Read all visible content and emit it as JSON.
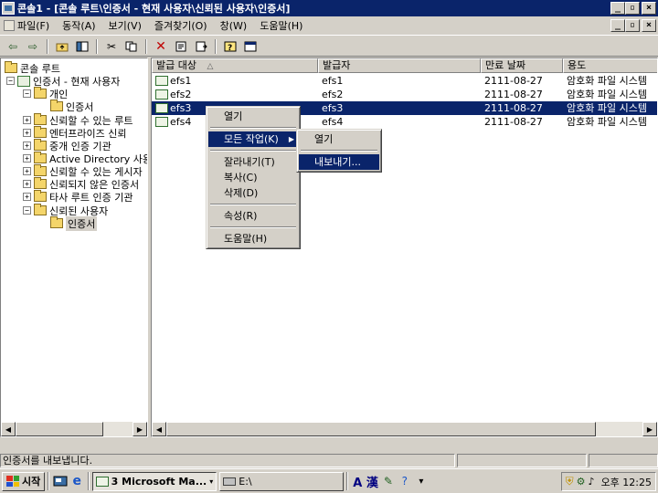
{
  "window": {
    "title": "콘솔1 - [콘솔 루트\\인증서 - 현재 사용자\\신뢰된 사용자\\인증서]",
    "minimize": "_",
    "restore": "▫",
    "close": "×"
  },
  "menu": {
    "items": [
      {
        "label": "파일(F)"
      },
      {
        "label": "동작(A)"
      },
      {
        "label": "보기(V)"
      },
      {
        "label": "즐겨찾기(O)"
      },
      {
        "label": "창(W)"
      },
      {
        "label": "도움말(H)"
      }
    ]
  },
  "tree": {
    "items": [
      {
        "label": "콘솔 루트"
      },
      {
        "label": "인증서 - 현재 사용자"
      },
      {
        "label": "개인"
      },
      {
        "label": "인증서"
      },
      {
        "label": "신뢰할 수 있는 루트"
      },
      {
        "label": "엔터프라이즈 신뢰"
      },
      {
        "label": "중개 인증 기관"
      },
      {
        "label": "Active Directory 사용"
      },
      {
        "label": "신뢰할 수 있는 게시자"
      },
      {
        "label": "신뢰되지 않은 인증서"
      },
      {
        "label": "타사 루트 인증 기관"
      },
      {
        "label": "신뢰된 사용자"
      },
      {
        "label": "인증서"
      }
    ]
  },
  "list": {
    "columns": [
      "발급 대상",
      "발급자",
      "만료 날짜",
      "용도"
    ],
    "sort_indicator": "△",
    "rows": [
      {
        "issued_to": "efs1",
        "issued_by": "efs1",
        "expires": "2111-08-27",
        "purpose": "암호화 파일 시스템"
      },
      {
        "issued_to": "efs2",
        "issued_by": "efs2",
        "expires": "2111-08-27",
        "purpose": "암호화 파일 시스템"
      },
      {
        "issued_to": "efs3",
        "issued_by": "efs3",
        "expires": "2111-08-27",
        "purpose": "암호화 파일 시스템"
      },
      {
        "issued_to": "efs4",
        "issued_by": "efs4",
        "expires": "2111-08-27",
        "purpose": "암호화 파일 시스템"
      }
    ]
  },
  "context_menu": {
    "items": [
      {
        "label": "열기"
      },
      {
        "label": "모든 작업(K)"
      },
      {
        "label": "잘라내기(T)"
      },
      {
        "label": "복사(C)"
      },
      {
        "label": "삭제(D)"
      },
      {
        "label": "속성(R)"
      },
      {
        "label": "도움말(H)"
      }
    ]
  },
  "submenu": {
    "items": [
      {
        "label": "열기"
      },
      {
        "label": "내보내기..."
      }
    ]
  },
  "status": {
    "text": "인증서를 내보냅니다."
  },
  "taskbar": {
    "start": "시작",
    "tasks": [
      {
        "label": "3 Microsoft Ma..."
      },
      {
        "label": "E:\\"
      }
    ],
    "ime": "A 漢",
    "clock": "오후 12:25"
  }
}
